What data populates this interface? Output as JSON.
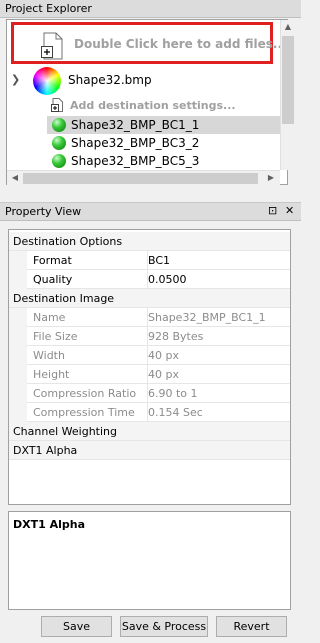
{
  "project_explorer": {
    "title": "Project Explorer",
    "add_files_text": "Double Click here to add files...",
    "tree": {
      "root_file": "Shape32.bmp",
      "add_destination_text": "Add destination settings...",
      "items": [
        {
          "label": "Shape32_BMP_BC1_1",
          "selected": true
        },
        {
          "label": "Shape32_BMP_BC3_2",
          "selected": false
        },
        {
          "label": "Shape32_BMP_BC5_3",
          "selected": false
        }
      ]
    }
  },
  "property_view": {
    "title": "Property View",
    "pin_glyph": "⊡",
    "close_glyph": "✕",
    "destination_options": {
      "header": "Destination Options",
      "format_label": "Format",
      "format_value": "BC1",
      "quality_label": "Quality",
      "quality_value": "0.0500"
    },
    "destination_image": {
      "header": "Destination Image",
      "name_label": "Name",
      "name_value": "Shape32_BMP_BC1_1",
      "filesize_label": "File Size",
      "filesize_value": "928 Bytes",
      "width_label": "Width",
      "width_value": "40 px",
      "height_label": "Height",
      "height_value": "40 px",
      "ratio_label": "Compression Ratio",
      "ratio_value": "6.90 to 1",
      "time_label": "Compression Time",
      "time_value": "0.154 Sec"
    },
    "channel_weighting": "Channel Weighting",
    "dxt1_alpha": "DXT1 Alpha"
  },
  "description": {
    "title": "DXT1 Alpha"
  },
  "buttons": {
    "save": "Save",
    "save_process": "Save & Process",
    "revert": "Revert"
  },
  "colors": {
    "highlight_border": "#e02020",
    "selected_row": "#d7d7d7",
    "disabled_text": "#8c8c8c"
  }
}
